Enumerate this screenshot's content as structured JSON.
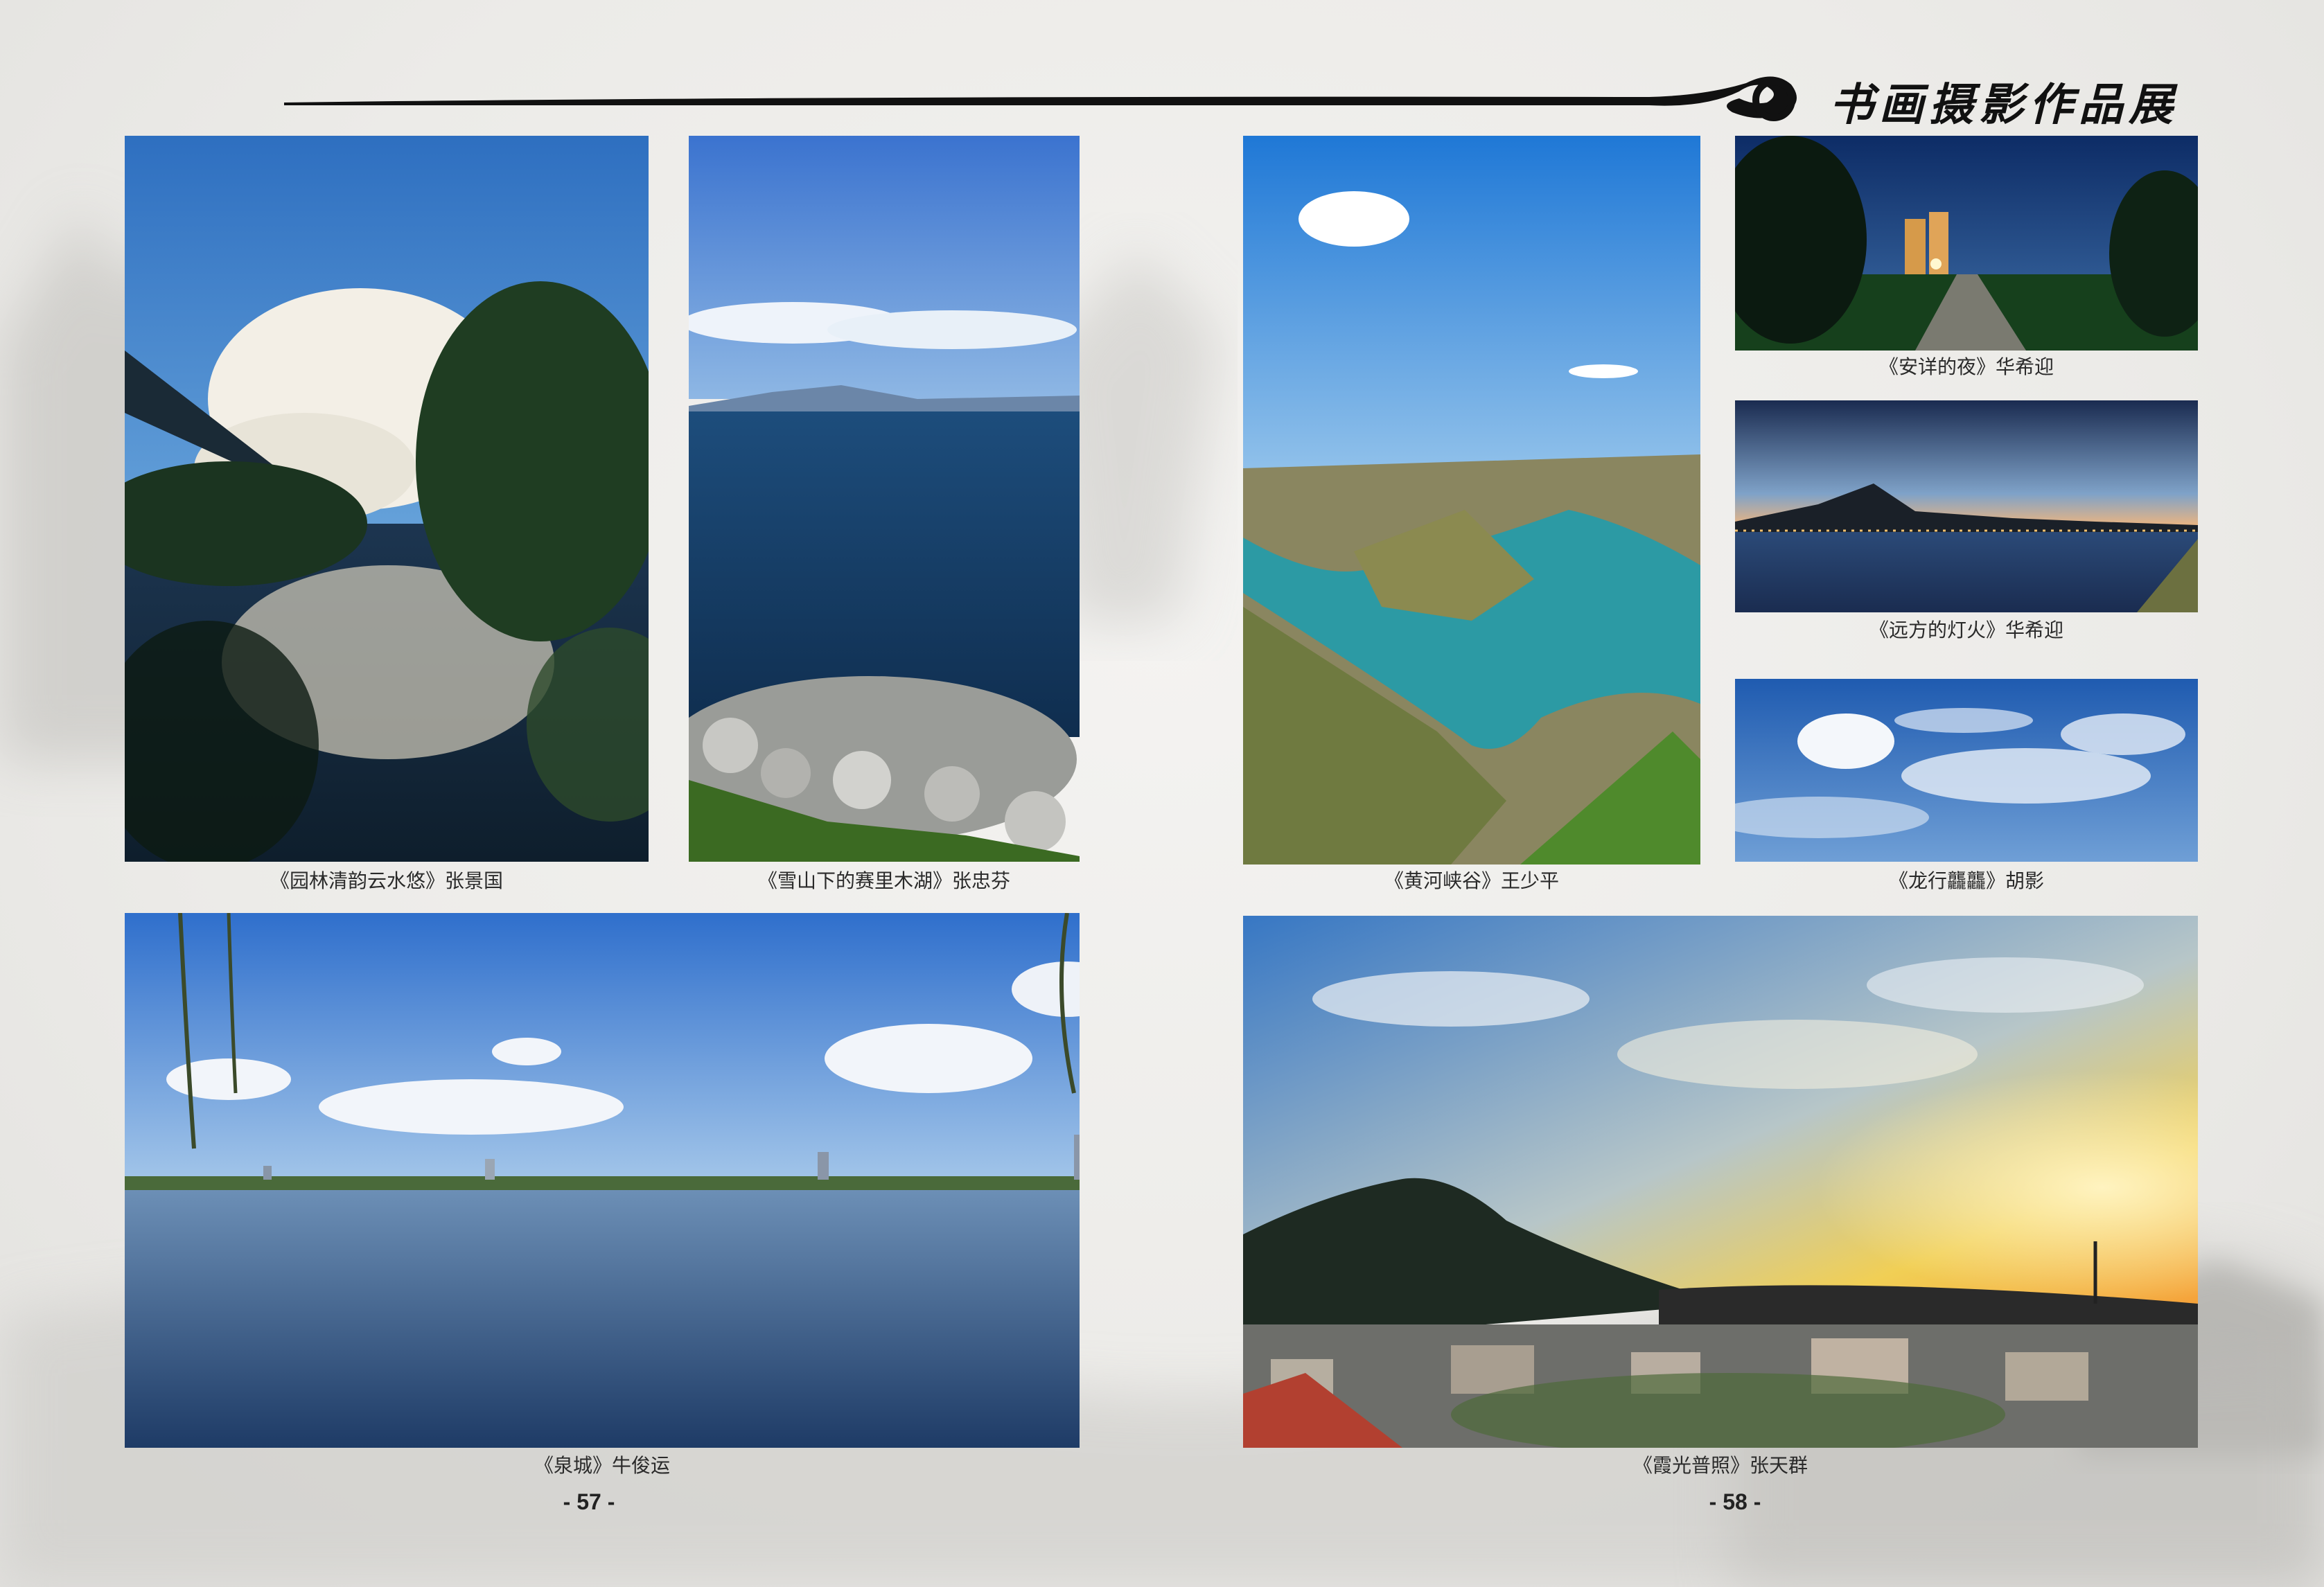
{
  "header": {
    "title": "书画摄影作品展"
  },
  "photos": [
    {
      "caption": "《园林清韵云水悠》张景国"
    },
    {
      "caption": "《雪山下的赛里木湖》张忠芬"
    },
    {
      "caption": "《黄河峡谷》王少平"
    },
    {
      "caption": "《安详的夜》华希迎"
    },
    {
      "caption": "《远方的灯火》华希迎"
    },
    {
      "caption": "《龙行龘龘》胡影"
    },
    {
      "caption": "《泉城》牛俊运"
    },
    {
      "caption": "《霞光普照》张天群"
    }
  ],
  "pages": {
    "left": "- 57 -",
    "right": "- 58 -"
  }
}
